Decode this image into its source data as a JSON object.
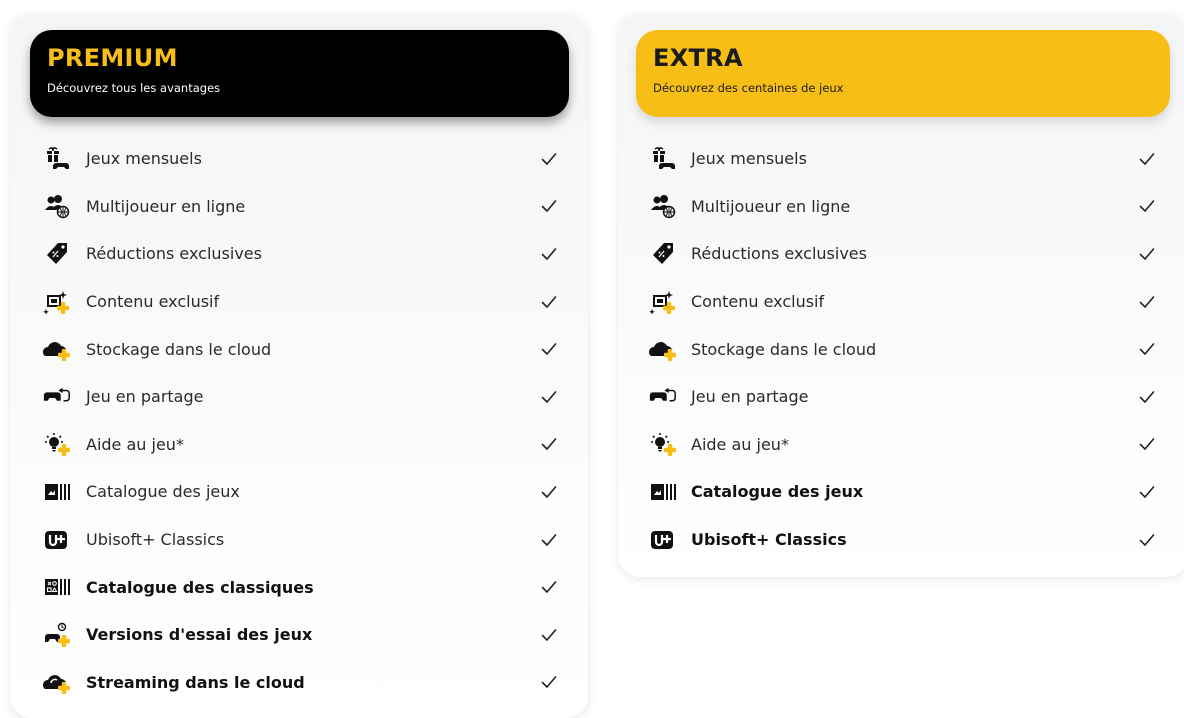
{
  "colors": {
    "premium_header_bg": "#000000",
    "premium_title": "#f7be16",
    "extra_header_bg": "#f7be16",
    "plus_accent": "#f7be16"
  },
  "plans": [
    {
      "name": "PREMIUM",
      "subtitle": "Découvrez tous les avantages",
      "features": [
        {
          "label": "Jeux mensuels",
          "icon": "monthly-games-icon",
          "bold": false,
          "included": true
        },
        {
          "label": "Multijoueur en ligne",
          "icon": "online-multiplayer-icon",
          "bold": false,
          "included": true
        },
        {
          "label": "Réductions exclusives",
          "icon": "discount-tag-icon",
          "bold": false,
          "included": true
        },
        {
          "label": "Contenu exclusif",
          "icon": "exclusive-content-icon",
          "bold": false,
          "included": true
        },
        {
          "label": "Stockage dans le cloud",
          "icon": "cloud-storage-icon",
          "bold": false,
          "included": true
        },
        {
          "label": "Jeu en partage",
          "icon": "share-play-icon",
          "bold": false,
          "included": true
        },
        {
          "label": "Aide au jeu*",
          "icon": "game-help-icon",
          "bold": false,
          "included": true
        },
        {
          "label": "Catalogue des jeux",
          "icon": "game-catalog-icon",
          "bold": false,
          "included": true
        },
        {
          "label": "Ubisoft+ Classics",
          "icon": "ubisoft-plus-icon",
          "bold": false,
          "included": true
        },
        {
          "label": "Catalogue des classiques",
          "icon": "classics-catalog-icon",
          "bold": true,
          "included": true
        },
        {
          "label": "Versions d'essai des jeux",
          "icon": "game-trials-icon",
          "bold": true,
          "included": true
        },
        {
          "label": "Streaming dans le cloud",
          "icon": "cloud-streaming-icon",
          "bold": true,
          "included": true
        }
      ]
    },
    {
      "name": "EXTRA",
      "subtitle": "Découvrez des centaines de jeux",
      "features": [
        {
          "label": "Jeux mensuels",
          "icon": "monthly-games-icon",
          "bold": false,
          "included": true
        },
        {
          "label": "Multijoueur en ligne",
          "icon": "online-multiplayer-icon",
          "bold": false,
          "included": true
        },
        {
          "label": "Réductions exclusives",
          "icon": "discount-tag-icon",
          "bold": false,
          "included": true
        },
        {
          "label": "Contenu exclusif",
          "icon": "exclusive-content-icon",
          "bold": false,
          "included": true
        },
        {
          "label": "Stockage dans le cloud",
          "icon": "cloud-storage-icon",
          "bold": false,
          "included": true
        },
        {
          "label": "Jeu en partage",
          "icon": "share-play-icon",
          "bold": false,
          "included": true
        },
        {
          "label": "Aide au jeu*",
          "icon": "game-help-icon",
          "bold": false,
          "included": true
        },
        {
          "label": "Catalogue des jeux",
          "icon": "game-catalog-icon",
          "bold": true,
          "included": true
        },
        {
          "label": "Ubisoft+ Classics",
          "icon": "ubisoft-plus-icon",
          "bold": true,
          "included": true
        }
      ]
    }
  ]
}
